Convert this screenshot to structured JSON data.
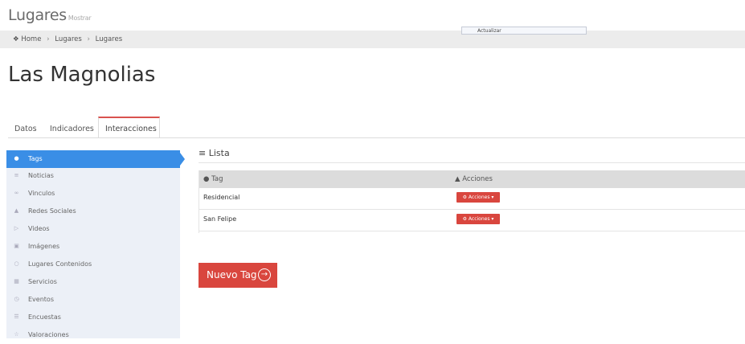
{
  "header": {
    "title": "Lugares",
    "subtitle": "Mostrar"
  },
  "breadcrumb": {
    "home_icon": "home-icon",
    "home": "Home",
    "items": [
      "Lugares",
      "Lugares"
    ]
  },
  "update": {
    "label": "Actualizar"
  },
  "page": {
    "title": "Las Magnolias"
  },
  "tabs": [
    {
      "label": "Datos"
    },
    {
      "label": "Indicadores"
    },
    {
      "label": "Interacciones",
      "active": true
    }
  ],
  "sidebar": {
    "items": [
      {
        "label": "Tags",
        "icon": "tag-icon",
        "active": true
      },
      {
        "label": "Noticias",
        "icon": "news-icon"
      },
      {
        "label": "Vinculos",
        "icon": "link-icon"
      },
      {
        "label": "Redes Sociales",
        "icon": "people-icon"
      },
      {
        "label": "Videos",
        "icon": "play-icon"
      },
      {
        "label": "Imágenes",
        "icon": "camera-icon"
      },
      {
        "label": "Lugares Contenidos",
        "icon": "pin-icon"
      },
      {
        "label": "Servicios",
        "icon": "grid-icon"
      },
      {
        "label": "Eventos",
        "icon": "clock-icon"
      },
      {
        "label": "Encuestas",
        "icon": "list-icon"
      },
      {
        "label": "Valoraciones",
        "icon": "star-icon"
      }
    ]
  },
  "lista": {
    "title": "Lista",
    "columns": {
      "tag": "Tag",
      "actions": "Acciones"
    },
    "rows": [
      {
        "tag": "Residencial",
        "action": "Acciones"
      },
      {
        "tag": "San Felipe",
        "action": "Acciones"
      }
    ]
  },
  "new_button": {
    "label": "Nuevo Tag"
  },
  "colors": {
    "accent": "#d9463e",
    "active": "#3a8ee6",
    "sidebar_bg": "#ecf0f7"
  }
}
